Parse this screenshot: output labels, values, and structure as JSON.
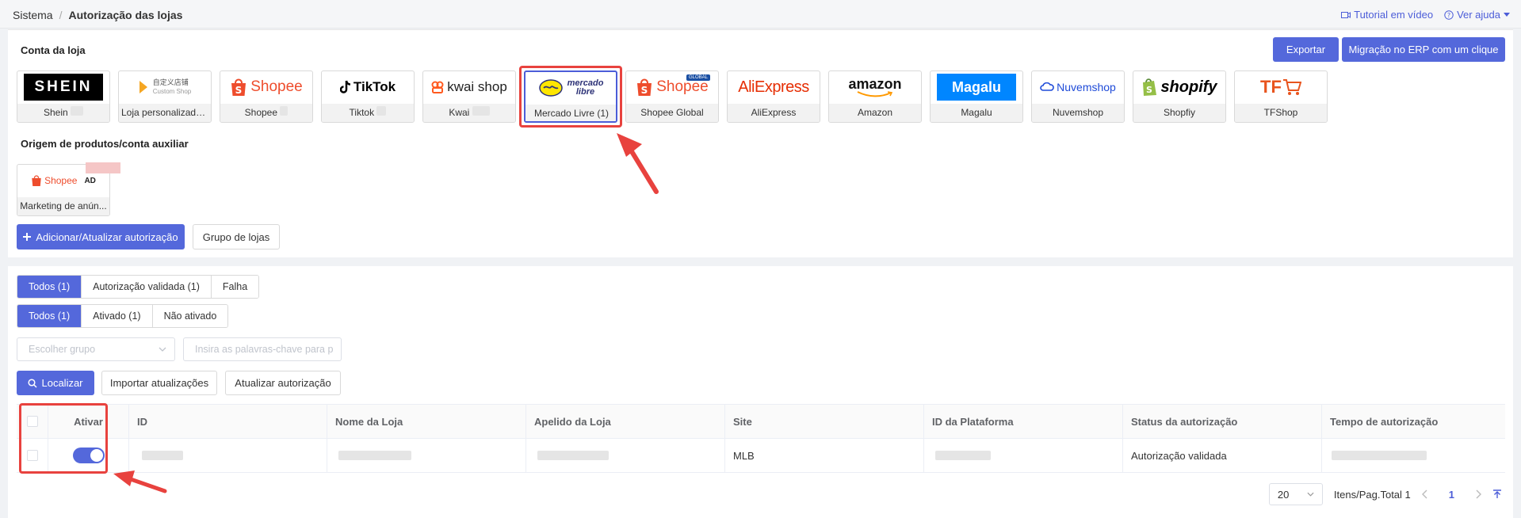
{
  "breadcrumb": {
    "root": "Sistema",
    "separator": "/",
    "current": "Autorização das lojas"
  },
  "top_links": {
    "tutorial": "Tutorial em vídeo",
    "help": "Ver ajuda"
  },
  "section_store": {
    "title": "Conta da loja",
    "export_label": "Exportar",
    "migrate_label": "Migração no ERP com um clique"
  },
  "platforms": [
    {
      "logo": "SHEIN",
      "label": "Shein"
    },
    {
      "logo": "自定义店铺",
      "logo_sub": "Custom Shop",
      "label": "Loja personalizada..."
    },
    {
      "logo": "Shopee",
      "label": "Shopee"
    },
    {
      "logo": "TikTok",
      "label": "Tiktok"
    },
    {
      "logo": "kwai shop",
      "label": "Kwai"
    },
    {
      "logo": "mercado libre",
      "label": "Mercado Livre (1)"
    },
    {
      "logo": "Shopee",
      "logo_badge": "GLOBAL",
      "label": "Shopee Global"
    },
    {
      "logo": "AliExpress",
      "label": "AliExpress"
    },
    {
      "logo": "amazon",
      "label": "Amazon"
    },
    {
      "logo": "Magalu",
      "label": "Magalu"
    },
    {
      "logo": "Nuvemshop",
      "label": "Nuvemshop"
    },
    {
      "logo": "shopify",
      "label": "Shopfiy"
    },
    {
      "logo": "TF",
      "label": "TFShop"
    }
  ],
  "section_origin": {
    "title": "Origem de produtos/conta auxiliar"
  },
  "origin_tile": {
    "logo": "Shopee",
    "logo_tag": "AD",
    "label": "Marketing de anún..."
  },
  "actions": {
    "add_label": "Adicionar/Atualizar autorização",
    "group_label": "Grupo de lojas"
  },
  "filter_auth": [
    "Todos (1)",
    "Autorização validada (1)",
    "Falha"
  ],
  "filter_active": [
    "Todos (1)",
    "Ativado (1)",
    "Não ativado"
  ],
  "search": {
    "group_placeholder": "Escolher grupo",
    "keyword_placeholder": "Insira as palavras-chave para p"
  },
  "buttons": {
    "find": "Localizar",
    "import": "Importar atualizações",
    "update": "Atualizar autorização"
  },
  "table": {
    "headers": [
      "Ativar",
      "ID",
      "Nome da Loja",
      "Apelido da Loja",
      "Site",
      "ID da Plataforma",
      "Status da autorização",
      "Tempo de autorização"
    ],
    "rows": [
      {
        "site": "MLB",
        "status": "Autorização validada"
      }
    ]
  },
  "pagination": {
    "page_size": "20",
    "summary": "Itens/Pag.Total 1",
    "current_page": "1"
  },
  "colors": {
    "primary": "#5468db",
    "highlight": "#e8423e"
  }
}
